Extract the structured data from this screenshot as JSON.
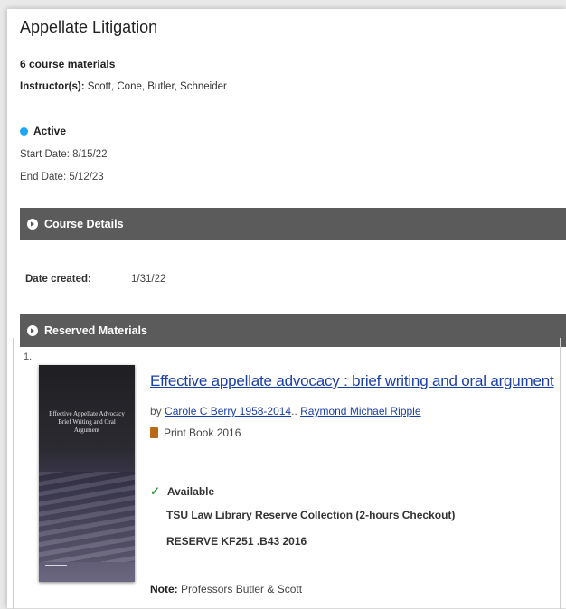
{
  "course": {
    "title": "Appellate Litigation",
    "materials_count": "6 course materials",
    "instructors_label": "Instructor(s):",
    "instructors": "Scott, Cone, Butler, Schneider",
    "status": "Active",
    "start_date": "Start Date: 8/15/22",
    "end_date": "End Date: 5/12/23"
  },
  "course_details": {
    "heading": "Course Details",
    "date_created_label": "Date created:",
    "date_created_value": "1/31/22"
  },
  "reserved": {
    "heading": "Reserved Materials",
    "items": [
      {
        "number": "1.",
        "title": "Effective appellate advocacy : brief writing and oral argument",
        "by": "by",
        "author1": "Carole C Berry 1958-2014",
        "separator": "..",
        "author2": "Raymond Michael Ripple",
        "format": "Print Book 2016",
        "availability": "Available",
        "location": "TSU Law Library Reserve Collection (2-hours Checkout)",
        "call_number": "RESERVE KF251 .B43 2016",
        "note_label": "Note:",
        "note": "Professors Butler & Scott",
        "cover_title": "Effective Appellate Advocacy Brief Writing and Oral Argument"
      }
    ]
  },
  "colors": {
    "section_bar": "#5b5b5b",
    "link": "#1a3fa8",
    "status_dot": "#1ea7f2",
    "check": "#2e9d3a",
    "book_icon": "#b86a16"
  },
  "icons": {
    "status": "status-dot-icon",
    "section": "chevron-circle-icon",
    "format": "book-icon",
    "availability": "check-icon"
  }
}
